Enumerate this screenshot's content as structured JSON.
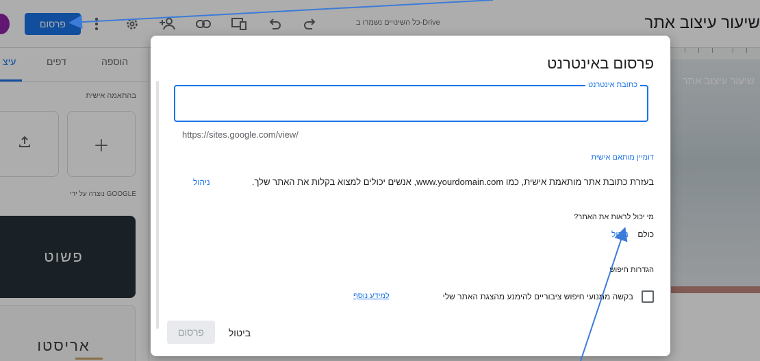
{
  "topbar": {
    "publish_label": "פרסום",
    "autosave_status": "כל השינויים נשמרו ב-Drive",
    "site_title": "שיעור עיצוב אתר",
    "icons": [
      "more-vert-icon",
      "settings-icon",
      "add-person-icon",
      "link-icon",
      "preview-icon",
      "undo-icon",
      "redo-icon"
    ]
  },
  "sidepanel": {
    "tabs": [
      "הוספה",
      "דפים",
      "עיצ"
    ],
    "active_tab": "עיצ",
    "section_label": "בהתאמה אישית",
    "created_by": "נוצרה על ידי GOOGLE",
    "themes": [
      "פשוט",
      "אריסטו"
    ]
  },
  "preview": {
    "heading": "שיעור עיצוב אתר"
  },
  "dialog": {
    "title": "פרסום באינטרנט",
    "field_label": "כתובת אינטרנט",
    "field_value": "",
    "url_prefix": "https://sites.google.com/view/",
    "custom_domain_heading": "דומיין מותאם אישית",
    "custom_domain_desc": "בעזרת כתובת אתר מותאמת אישית, כמו www.yourdomain.com, אנשים יכולים למצוא בקלות את האתר שלך.",
    "manage_label": "ניהול",
    "who_can_see_question": "מי יכול לראות את האתר?",
    "who_can_see_value": "כולם",
    "search_settings_heading": "הגדרות חיפוש",
    "search_checkbox_label": "בקשה ממנועי חיפוש ציבוריים להימנע מהצגת האתר שלי",
    "search_checkbox_checked": false,
    "learn_more": "למידע נוסף",
    "cancel_label": "ביטול",
    "publish_label": "פרסום"
  },
  "colors": {
    "accent": "#1a73e8",
    "annotation_arrow": "#3d7bd8"
  }
}
